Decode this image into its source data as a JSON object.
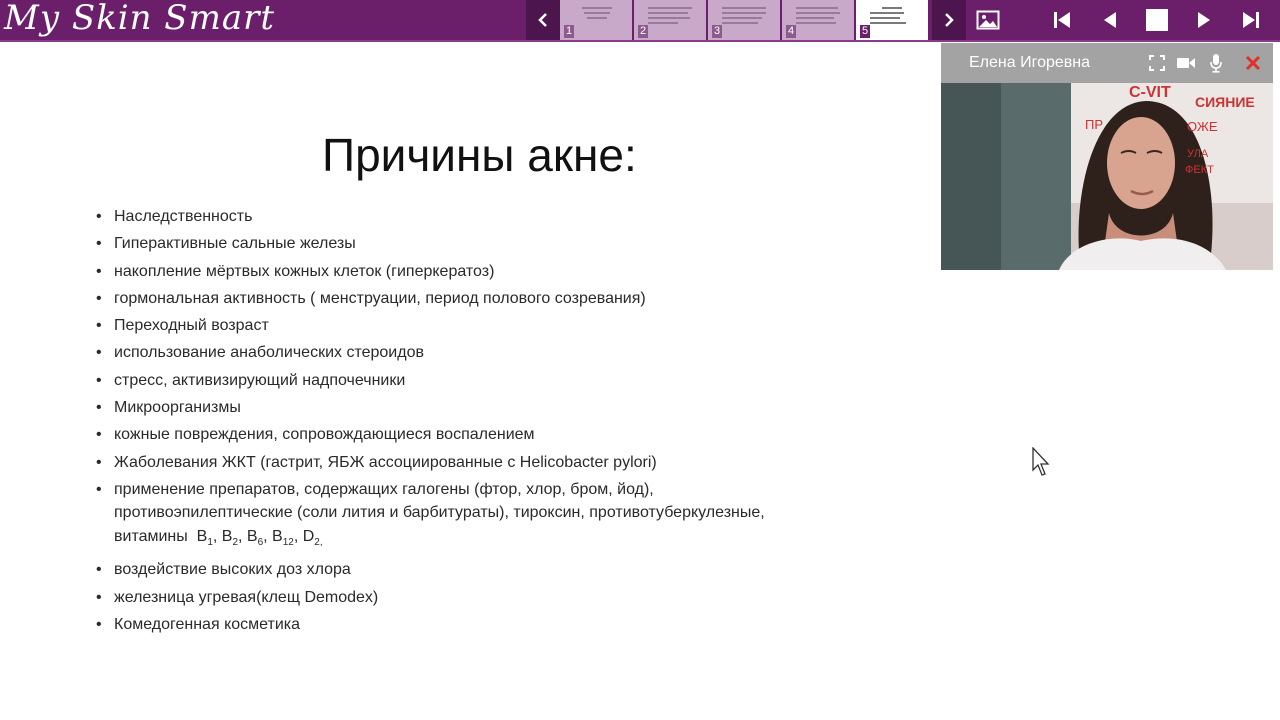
{
  "header": {
    "logo": "My Skin Smart",
    "thumbnails": [
      {
        "number": "1"
      },
      {
        "number": "2"
      },
      {
        "number": "3"
      },
      {
        "number": "4"
      },
      {
        "number": "5"
      }
    ],
    "active_slide": 5,
    "icons": {
      "thumbs_prev": "chevron-left-icon",
      "thumbs_next": "chevron-right-icon",
      "image": "image-icon",
      "first": "skip-to-start-icon",
      "prev": "previous-icon",
      "stop": "stop-icon",
      "next": "play-next-icon",
      "last": "skip-to-end-icon"
    },
    "brand_color": "#6b1f6b"
  },
  "slide": {
    "title": "Причины акне:",
    "bullets": [
      {
        "text": "Наследственность"
      },
      {
        "text": "Гиперактивные сальные железы"
      },
      {
        "text": "накопление мёртвых кожных клеток (гиперкератоз)"
      },
      {
        "text": "гормональная активность ( менструации, период полового созревания)"
      },
      {
        "text": "Переходный возраст"
      },
      {
        "text": "использование анаболических стероидов"
      },
      {
        "text": "стресс, активизирующий надпочечники"
      },
      {
        "text": "Микроорганизмы"
      },
      {
        "text": "кожные повреждения, сопровождающиеся воспалением"
      },
      {
        "text": "Жаболевания ЖКТ (гастрит, ЯБЖ ассоциированные с Helicobacter pylori)"
      },
      {
        "line1": "применение препаратов, содержащих галогены (фтор, хлор, бром, йод),",
        "line2": "противоэпилептические (соли лития и барбитураты), тироксин, противотуберкулезные,",
        "vitamins_label": "витамины",
        "vitamins": [
          {
            "letter": "B",
            "sub": "1"
          },
          {
            "letter": "B",
            "sub": "2"
          },
          {
            "letter": "B",
            "sub": "6"
          },
          {
            "letter": "B",
            "sub": "12"
          },
          {
            "letter": "D",
            "sub": "2"
          }
        ]
      },
      {
        "text": "воздействие высоких доз хлора"
      },
      {
        "text": "железница угревая(клещ Demodex)"
      },
      {
        "text": "Комедогенная косметика"
      }
    ]
  },
  "video": {
    "presenter": "Елена Игоревна",
    "background_sign": {
      "line1": "C-VIT",
      "line2": "СИЯНИЕ",
      "line3": "ПР",
      "line4": "ОЖЕ",
      "line5": "УЛА",
      "line6": "ФЕКТ"
    },
    "icons": [
      "fullscreen-icon",
      "camera-icon",
      "microphone-icon",
      "close-icon"
    ],
    "close_color": "#e0302a"
  }
}
